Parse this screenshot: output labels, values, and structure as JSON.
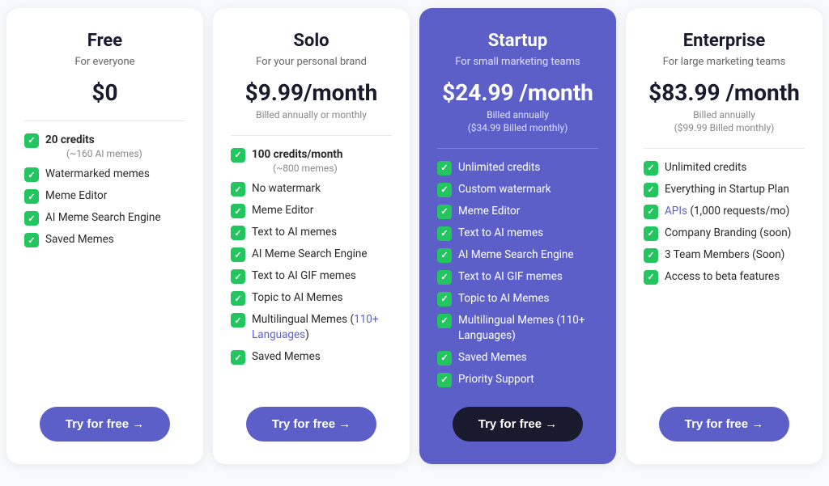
{
  "plans": [
    {
      "id": "free",
      "name": "Free",
      "tagline": "For everyone",
      "price": "$0",
      "billing": "",
      "billing_sub": "",
      "featured": false,
      "features": [
        {
          "text": "20 credits",
          "bold": true,
          "sub": "(~160 AI memes)"
        },
        {
          "text": "Watermarked memes"
        },
        {
          "text": "Meme Editor"
        },
        {
          "text": "AI Meme Search Engine"
        },
        {
          "text": "Saved Memes"
        }
      ],
      "cta": "Try for free →"
    },
    {
      "id": "solo",
      "name": "Solo",
      "tagline": "For your personal brand",
      "price": "$9.99/month",
      "billing": "Billed annually or monthly",
      "billing_sub": "",
      "featured": false,
      "features": [
        {
          "text": "100 credits/month",
          "bold": true,
          "sub": "(~800 memes)"
        },
        {
          "text": "No watermark"
        },
        {
          "text": "Meme Editor"
        },
        {
          "text": "Text to AI memes"
        },
        {
          "text": "AI Meme Search Engine"
        },
        {
          "text": "Text to AI GIF memes"
        },
        {
          "text": "Topic to AI Memes"
        },
        {
          "text": "Multilingual Memes (",
          "link_text": "110+ Languages",
          "after_link": ")"
        },
        {
          "text": "Saved Memes"
        }
      ],
      "cta": "Try for free →"
    },
    {
      "id": "startup",
      "name": "Startup",
      "tagline": "For small marketing teams",
      "price": "$24.99 /month",
      "billing": "Billed annually",
      "billing_sub": "($34.99 Billed monthly)",
      "featured": true,
      "features": [
        {
          "text": "Unlimited credits"
        },
        {
          "text": "Custom watermark"
        },
        {
          "text": "Meme Editor"
        },
        {
          "text": "Text to AI memes"
        },
        {
          "text": "AI Meme Search Engine"
        },
        {
          "text": "Text to AI GIF memes"
        },
        {
          "text": "Topic to AI Memes"
        },
        {
          "text": "Multilingual Memes (110+ Languages)"
        },
        {
          "text": "Saved Memes"
        },
        {
          "text": "Priority Support"
        }
      ],
      "cta": "Try for free →"
    },
    {
      "id": "enterprise",
      "name": "Enterprise",
      "tagline": "For large marketing teams",
      "price": "$83.99 /month",
      "billing": "Billed annually",
      "billing_sub": "($99.99 Billed monthly)",
      "featured": false,
      "features": [
        {
          "text": "Unlimited credits"
        },
        {
          "text": "Everything in Startup Plan"
        },
        {
          "text": "APIs",
          "link": true,
          "after_link": " (1,000 requests/mo)"
        },
        {
          "text": "Company Branding (soon)"
        },
        {
          "text": "3 Team Members (Soon)"
        },
        {
          "text": "Access to beta features"
        }
      ],
      "cta": "Try for free →"
    }
  ]
}
